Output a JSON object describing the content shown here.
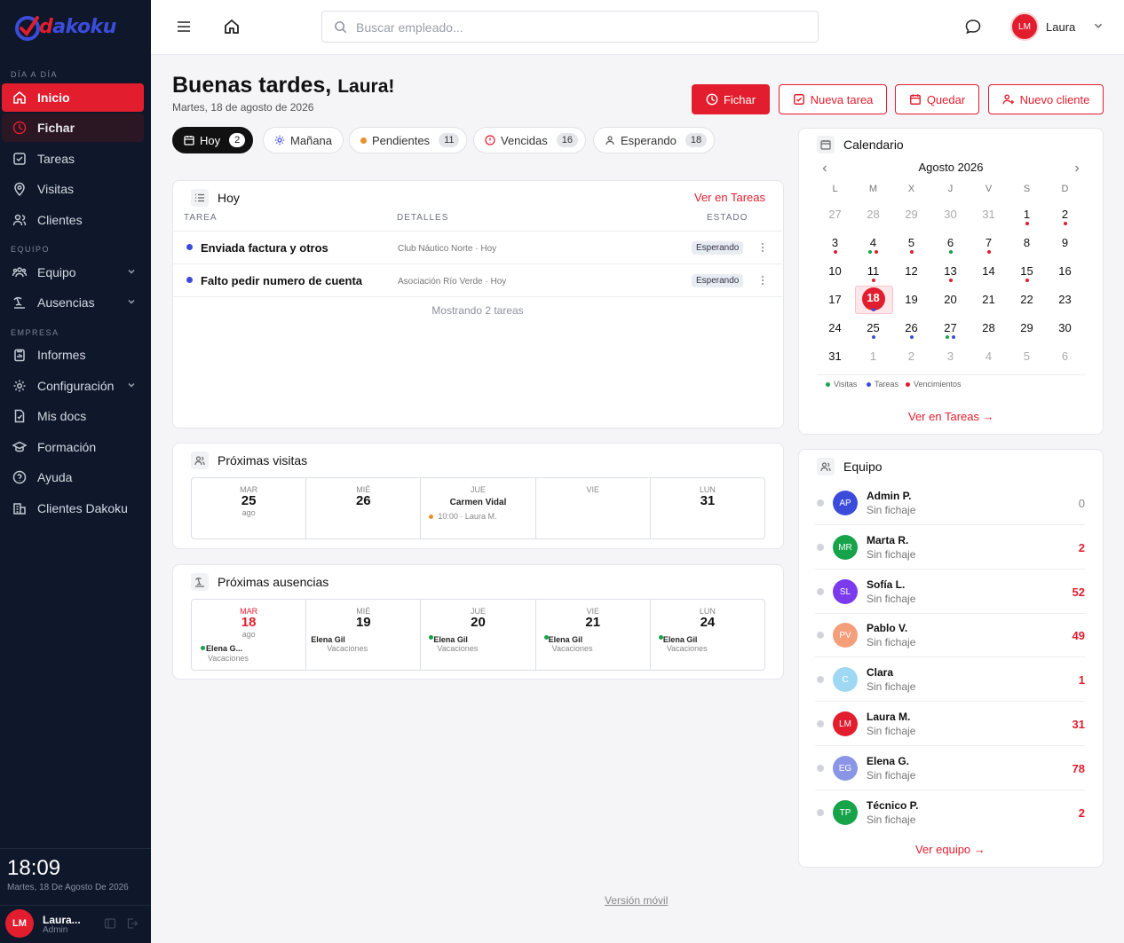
{
  "app": {
    "logo_text": "dakoku",
    "logo_d": "d"
  },
  "sidebar": {
    "sections": [
      "DÍA A DÍA",
      "EQUIPO",
      "EMPRESA"
    ],
    "items": [
      {
        "label": "Inicio"
      },
      {
        "label": "Fichar"
      },
      {
        "label": "Tareas"
      },
      {
        "label": "Visitas"
      },
      {
        "label": "Clientes"
      },
      {
        "label": "Equipo"
      },
      {
        "label": "Ausencias"
      },
      {
        "label": "Informes"
      },
      {
        "label": "Configuración"
      },
      {
        "label": "Mis docs"
      },
      {
        "label": "Formación"
      },
      {
        "label": "Ayuda"
      },
      {
        "label": "Clientes Dakoku"
      }
    ],
    "clock": "18:09",
    "clock_date": "Martes, 18 De Agosto De 2026",
    "user": {
      "initials": "LM",
      "name": "Laura...",
      "role": "Admin"
    }
  },
  "topbar": {
    "search_placeholder": "Buscar empleado...",
    "user_initials": "LM",
    "user_name": "Laura"
  },
  "greeting": {
    "prefix": "Buenas tardes,",
    "name": "Laura!",
    "date": "Martes, 18 de agosto de 2026"
  },
  "actions": {
    "fichar": "Fichar",
    "nueva_tarea": "Nueva tarea",
    "quedar": "Quedar",
    "nuevo_cliente": "Nuevo cliente"
  },
  "filters": [
    {
      "label": "Hoy",
      "count": "2"
    },
    {
      "label": "Mañana"
    },
    {
      "label": "Pendientes",
      "count": "11"
    },
    {
      "label": "Vencidas",
      "count": "16"
    },
    {
      "label": "Esperando",
      "count": "18"
    }
  ],
  "today_card": {
    "title": "Hoy",
    "link": "Ver en Tareas",
    "headers": [
      "TAREA",
      "DETALLES",
      "ESTADO"
    ],
    "rows": [
      {
        "title": "Enviada factura y otros",
        "details": "Club Náutico Norte · Hoy",
        "status": "Esperando"
      },
      {
        "title": "Falto pedir numero de cuenta",
        "details": "Asociación Río Verde · Hoy",
        "status": "Esperando"
      }
    ],
    "footer": "Mostrando 2 tareas"
  },
  "visits": {
    "title": "Próximas visitas",
    "days": [
      {
        "dow": "MAR",
        "num": "25",
        "month": "ago"
      },
      {
        "dow": "MIÉ",
        "num": "26"
      },
      {
        "dow": "JUE",
        "event_name": "Carmen Vidal",
        "event_time": "10:00 · Laura M."
      },
      {
        "dow": "VIE"
      },
      {
        "dow": "LUN",
        "num": "31"
      }
    ]
  },
  "absences": {
    "title": "Próximas ausencias",
    "days": [
      {
        "dow": "MAR",
        "num": "18",
        "month": "ago",
        "name": "Elena G...",
        "type": "Vacaciones"
      },
      {
        "dow": "MIÉ",
        "num": "19",
        "name": "Elena Gil",
        "type": "Vacaciones"
      },
      {
        "dow": "JUE",
        "num": "20",
        "name": "Elena Gil",
        "type": "Vacaciones"
      },
      {
        "dow": "VIE",
        "num": "21",
        "name": "Elena Gil",
        "type": "Vacaciones"
      },
      {
        "dow": "LUN",
        "num": "24",
        "name": "Elena Gil",
        "type": "Vacaciones"
      }
    ]
  },
  "calendar": {
    "title": "Calendario",
    "month": "Agosto 2026",
    "weekdays": [
      "L",
      "M",
      "X",
      "J",
      "V",
      "S",
      "D"
    ],
    "weeks": [
      [
        "27",
        "28",
        "29",
        "30",
        "31",
        "1",
        "2"
      ],
      [
        "3",
        "4",
        "5",
        "6",
        "7",
        "8",
        "9"
      ],
      [
        "10",
        "11",
        "12",
        "13",
        "14",
        "15",
        "16"
      ],
      [
        "17",
        "18",
        "19",
        "20",
        "21",
        "22",
        "23"
      ],
      [
        "24",
        "25",
        "26",
        "27",
        "28",
        "29",
        "30"
      ],
      [
        "31",
        "1",
        "2",
        "3",
        "4",
        "5",
        "6"
      ]
    ],
    "legend": [
      "Visitas",
      "Tareas",
      "Vencimientos"
    ],
    "link": "Ver en Tareas →"
  },
  "team": {
    "title": "Equipo",
    "members": [
      {
        "initials": "AP",
        "name": "Admin P.",
        "status": "Sin fichaje",
        "count": "0",
        "color": "#3b4cdb"
      },
      {
        "initials": "MR",
        "name": "Marta R.",
        "status": "Sin fichaje",
        "count": "2",
        "color": "#16a34a"
      },
      {
        "initials": "SL",
        "name": "Sofía L.",
        "status": "Sin fichaje",
        "count": "52",
        "color": "#7c3aed"
      },
      {
        "initials": "PV",
        "name": "Pablo V.",
        "status": "Sin fichaje",
        "count": "49",
        "color": "#f59e7a"
      },
      {
        "initials": "C",
        "name": "Clara",
        "status": "Sin fichaje",
        "count": "1",
        "color": "#9fd8f2"
      },
      {
        "initials": "LM",
        "name": "Laura M.",
        "status": "Sin fichaje",
        "count": "31",
        "color": "#e11d2e"
      },
      {
        "initials": "EG",
        "name": "Elena G.",
        "status": "Sin fichaje",
        "count": "78",
        "color": "#8b95e6"
      },
      {
        "initials": "TP",
        "name": "Técnico P.",
        "status": "Sin fichaje",
        "count": "2",
        "color": "#16a34a"
      }
    ],
    "link": "Ver equipo →"
  },
  "footer": {
    "mobile": "Versión móvil"
  },
  "colors": {
    "accent": "#e11d2e",
    "sidebar": "#0f172a",
    "visits": "#16a34a",
    "tasks": "#3b4cdb",
    "due": "#e11d2e"
  }
}
